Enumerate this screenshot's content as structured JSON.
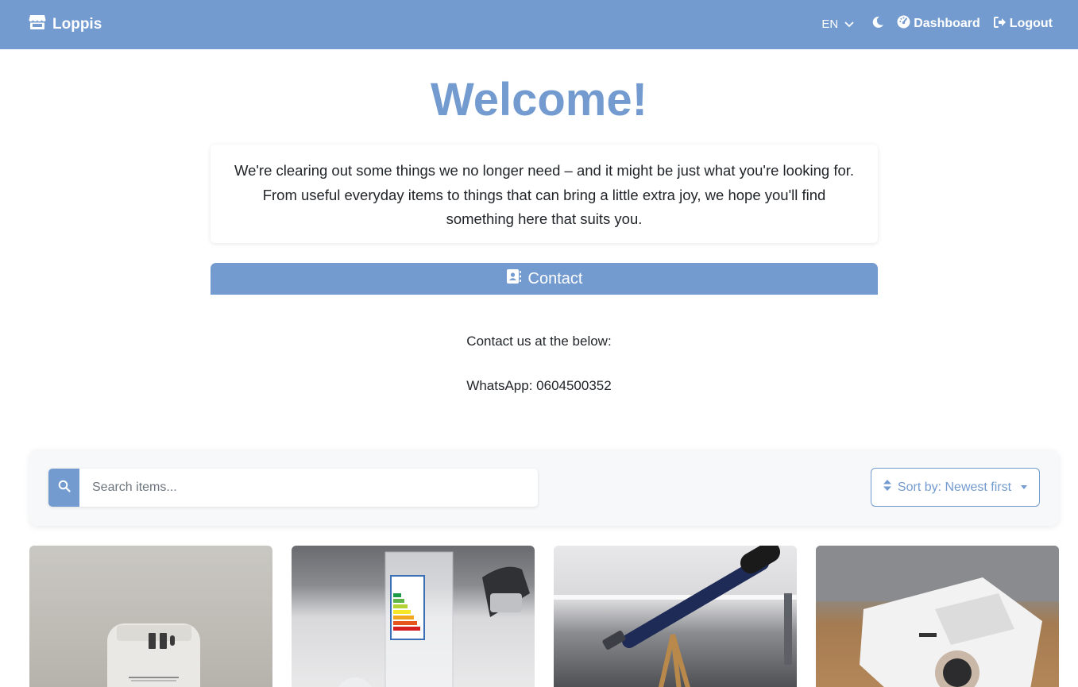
{
  "nav": {
    "brand": "Loppis",
    "lang": "EN",
    "dashboard": "Dashboard",
    "logout": "Logout"
  },
  "main": {
    "title": "Welcome!",
    "intro": "We're clearing out some things we no longer need – and it might be just what you're looking for. From useful everyday items to things that can bring a little extra joy, we hope you'll find something here that suits you.",
    "contact_button": "Contact",
    "contact_line1": "Contact us at the below:",
    "contact_line2": "WhatsApp: 0604500352"
  },
  "toolbar": {
    "search_placeholder": "Search items...",
    "sort_label": "Sort by: Newest first"
  },
  "items": [
    {
      "image": "usb-charger-photo"
    },
    {
      "image": "led-bulb-photo"
    },
    {
      "image": "telescope-photo"
    },
    {
      "image": "projector-photo"
    }
  ],
  "colors": {
    "accent": "#739bcf",
    "text": "#212529",
    "toolbar_bg": "#f6f8fa"
  }
}
